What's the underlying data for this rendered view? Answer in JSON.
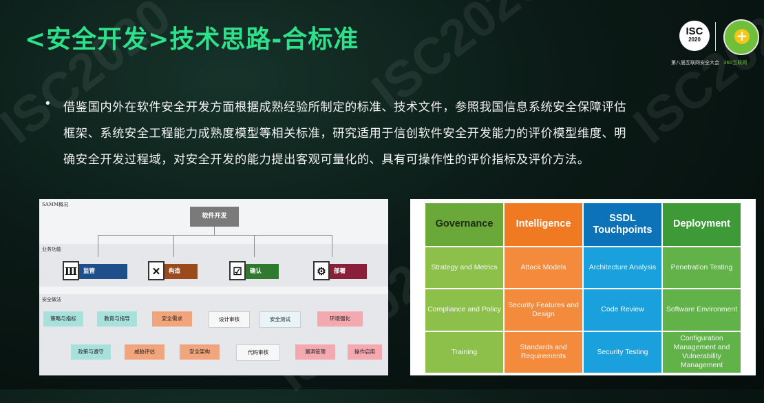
{
  "slide": {
    "title": "<安全开发>技术思路-合标准",
    "bullet_lines": [
      "借鉴国内外在软件安全开发方面根据成熟经验所制定的标准、技术文件，参照我国信息系统安全保障评估",
      "框架、系统安全工程能力成熟度模型等相关标准，研究适用于信创软件安全开发能力的评价模型维度、明",
      "确安全开发过程域，对安全开发的能力提出客观可量化的、具有可操作性的评价指标及评价方法。"
    ]
  },
  "logo": {
    "isc_text": "ISC",
    "isc_year": "2020",
    "caption": "第八届互联网安全大会",
    "caption_brand": "360互联网"
  },
  "samm": {
    "header": "SAMM概况",
    "top": "软件开发",
    "band_functions": "业务功能",
    "band_practices": "安全做法",
    "functions": [
      "监管",
      "构造",
      "确认",
      "部署"
    ],
    "function_icons": [
      "building-icon",
      "tools-icon",
      "checklist-icon",
      "gears-icon"
    ],
    "practices_row1": [
      "策略与指标",
      "教育与指导",
      "安全需求",
      "设计审核",
      "安全测试",
      "环境强化"
    ],
    "practices_row2": [
      "政策与遵守",
      "威胁评估",
      "安全架构",
      "代码审核",
      "漏洞管理",
      "操作启用"
    ]
  },
  "bsimm": {
    "headers": [
      "Governance",
      "Intelligence",
      "SSDL Touchpoints",
      "Deployment"
    ],
    "rows": [
      [
        "Strategy and Metrics",
        "Attack Models",
        "Architecture Analysis",
        "Penetration Testing"
      ],
      [
        "Compliance and Policy",
        "Security Features and Design",
        "Code Review",
        "Software Environment"
      ],
      [
        "Training",
        "Standards and Requirements",
        "Security Testing",
        "Configuration Management and Vulnerability Management"
      ]
    ]
  }
}
